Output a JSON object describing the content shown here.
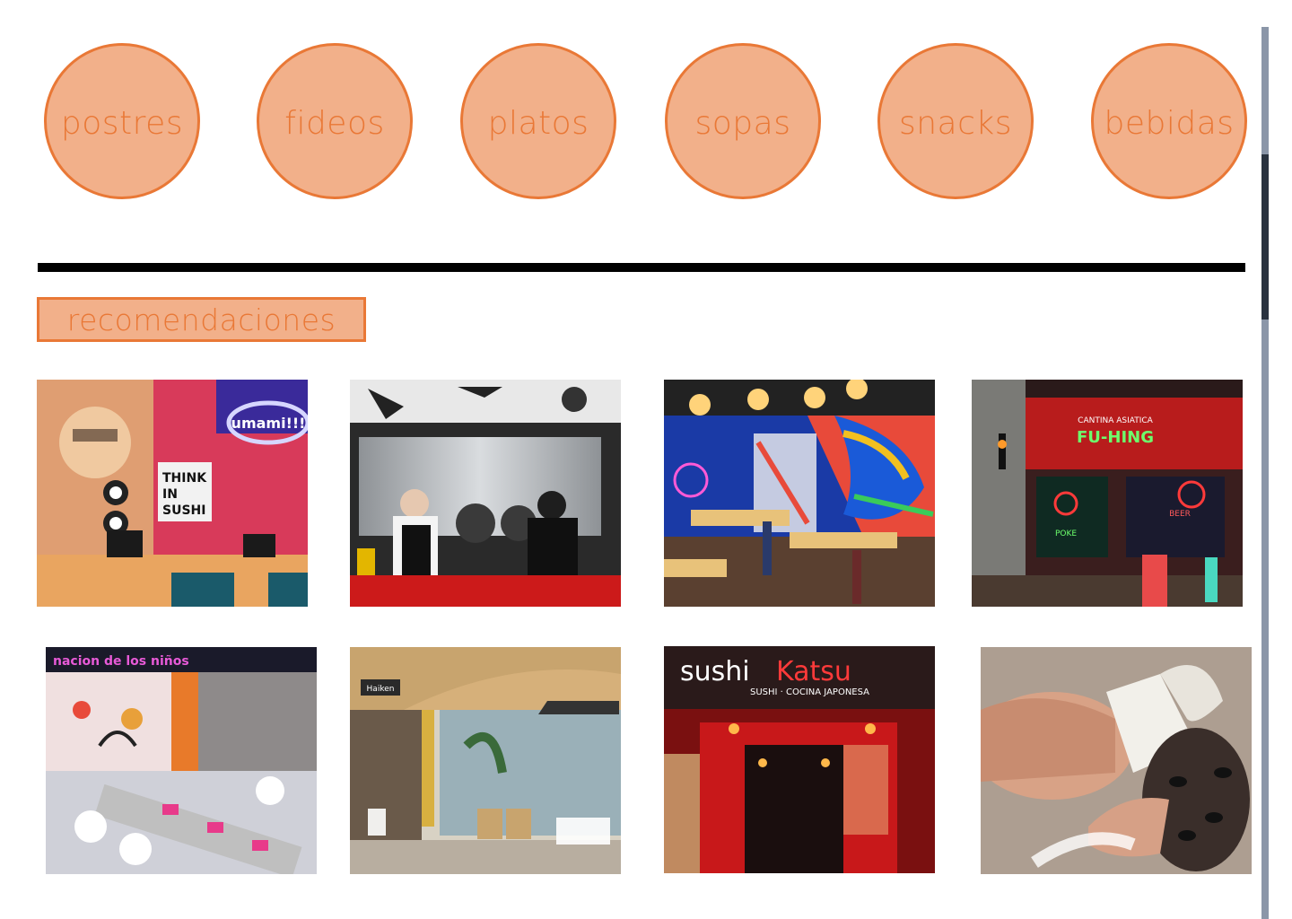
{
  "colors": {
    "accent": "#e97836",
    "accent_fill": "#f2b08a",
    "divider": "#000000"
  },
  "categories": [
    {
      "label": "postres"
    },
    {
      "label": "fideos"
    },
    {
      "label": "platos"
    },
    {
      "label": "sopas"
    },
    {
      "label": "snacks"
    },
    {
      "label": "bebidas"
    }
  ],
  "recommendations": {
    "title": "recomendaciones",
    "photos": [
      {
        "name": "umami-sushi-mural-photo",
        "signs": [
          "THINK IN SUSHI",
          "umami!!!"
        ]
      },
      {
        "name": "open-kitchen-chefs-photo",
        "signs": []
      },
      {
        "name": "dragon-mural-dining-room-photo",
        "signs": []
      },
      {
        "name": "fu-hing-cantina-storefront-photo",
        "signs": [
          "CANTINA ASIATICA",
          "FU-HING",
          "POKE",
          "BEER"
        ]
      },
      {
        "name": "nacion-de-los-ninos-dining-photo",
        "signs": [
          "nacion de los niños"
        ]
      },
      {
        "name": "haiken-restaurant-patio-photo",
        "signs": [
          "Haiken"
        ]
      },
      {
        "name": "sushi-katsu-storefront-photo",
        "signs": [
          "sushiKatsu",
          "SUSHI · COCINA JAPONESA"
        ]
      },
      {
        "name": "ice-cream-cone-photo",
        "signs": []
      }
    ]
  }
}
